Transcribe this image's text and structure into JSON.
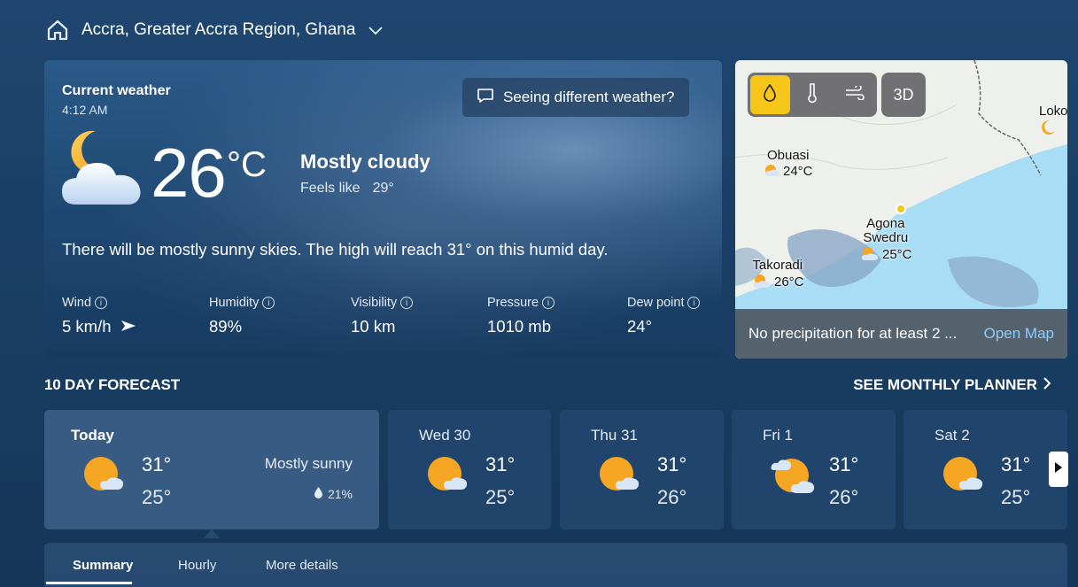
{
  "header": {
    "location": "Accra, Greater Accra Region, Ghana",
    "home_icon": "home-icon",
    "dropdown_icon": "chevron-down-icon"
  },
  "current": {
    "title": "Current weather",
    "time": "4:12 AM",
    "feedback_button": "Seeing different weather?",
    "temperature": "26",
    "unit": "°C",
    "condition": "Mostly cloudy",
    "feels_like_label": "Feels like",
    "feels_like_value": "29°",
    "summary": "There will be mostly sunny skies. The high will reach 31° on this humid day.",
    "stats": [
      {
        "label": "Wind",
        "value": "5 km/h"
      },
      {
        "label": "Humidity",
        "value": "89%"
      },
      {
        "label": "Visibility",
        "value": "10 km"
      },
      {
        "label": "Pressure",
        "value": "1010 mb"
      },
      {
        "label": "Dew point",
        "value": "24°"
      }
    ],
    "info_glyph": "i"
  },
  "map": {
    "layer_3d": "3D",
    "cities": [
      {
        "name": "Obuasi",
        "temp": "24°C"
      },
      {
        "name": "Agona",
        "name2": "Swedru",
        "temp": "25°C"
      },
      {
        "name": "Takoradi",
        "temp": "26°C"
      },
      {
        "name": "Loko"
      }
    ],
    "footer_text": "No precipitation for at least 2 ...",
    "open_map": "Open Map",
    "accent": "#f5c518"
  },
  "forecast": {
    "title": "10 DAY FORECAST",
    "planner_link": "SEE MONTHLY PLANNER",
    "days": [
      {
        "day": "Today",
        "high": "31°",
        "low": "25°",
        "condition": "Mostly sunny",
        "precip": "21%"
      },
      {
        "day": "Wed 30",
        "high": "31°",
        "low": "25°"
      },
      {
        "day": "Thu 31",
        "high": "31°",
        "low": "26°"
      },
      {
        "day": "Fri 1",
        "high": "31°",
        "low": "26°"
      },
      {
        "day": "Sat 2",
        "high": "31°",
        "low": "25°"
      }
    ]
  },
  "tabs": [
    {
      "label": "Summary"
    },
    {
      "label": "Hourly"
    },
    {
      "label": "More details"
    }
  ]
}
